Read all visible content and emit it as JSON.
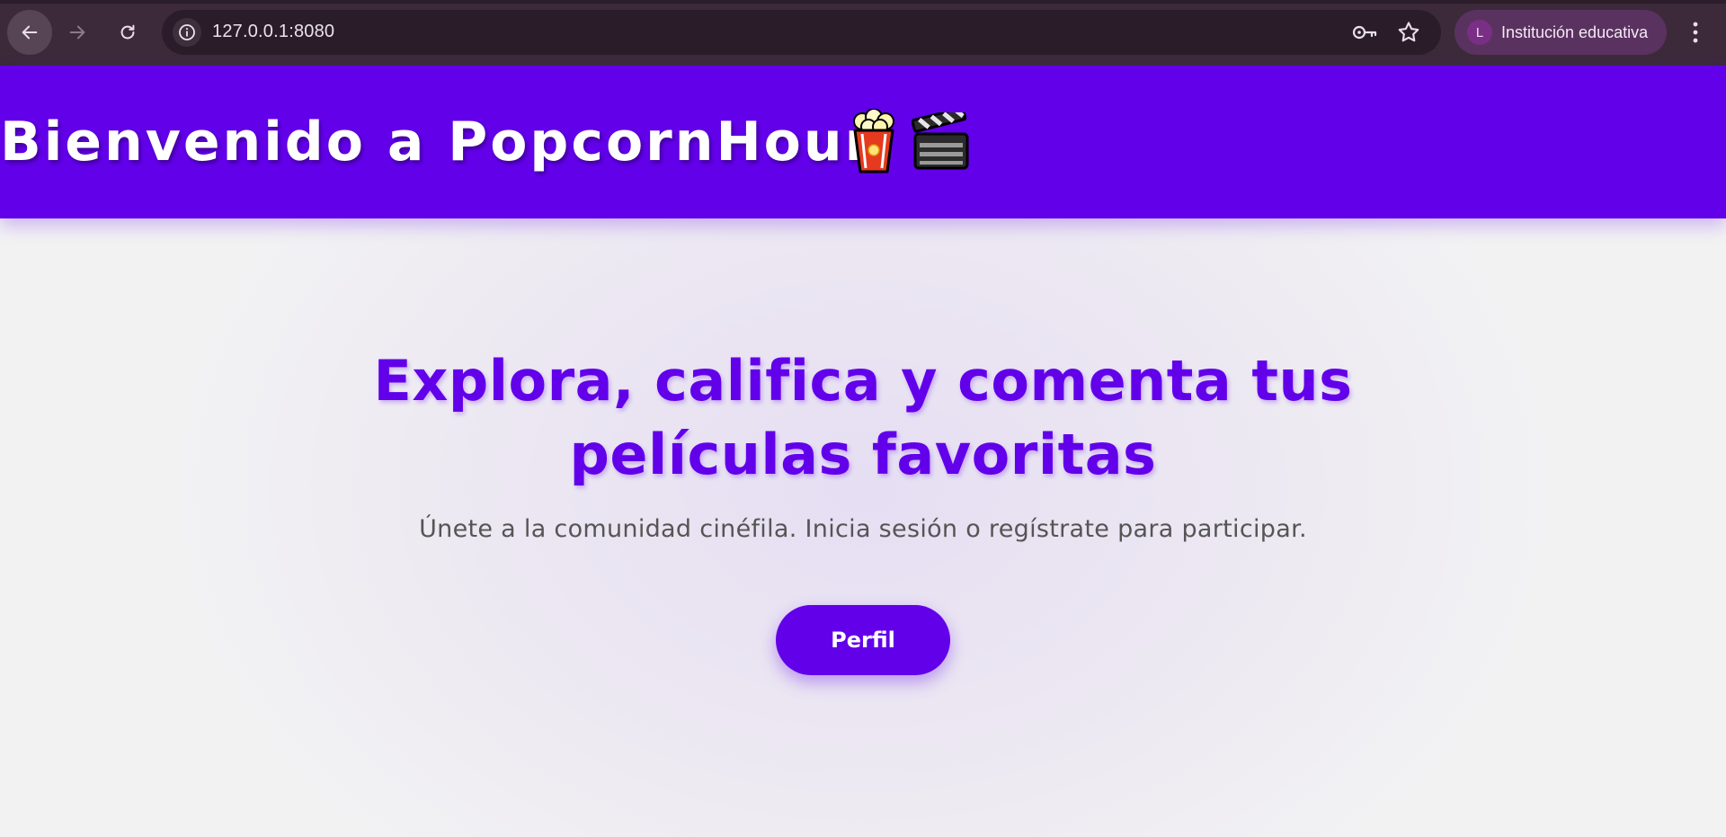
{
  "browser": {
    "url": "127.0.0.1:8080",
    "profile_initial": "L",
    "profile_name": "Institución educativa"
  },
  "header": {
    "title": "Bienvenido a PopcornHour",
    "icons": [
      "popcorn-icon",
      "clapper-board-icon"
    ],
    "background": "#6200ea"
  },
  "hero": {
    "title_line1": "Explora, califica y comenta tus",
    "title_line2": "películas favoritas",
    "subtitle": "Únete a la comunidad cinéfila. Inicia sesión o regístrate para participar.",
    "button_label": "Perfil"
  },
  "colors": {
    "accent": "#6200ea",
    "chrome": "#3c2a3a",
    "page_bg": "#f2f2f3",
    "subtitle_text": "#555555"
  }
}
